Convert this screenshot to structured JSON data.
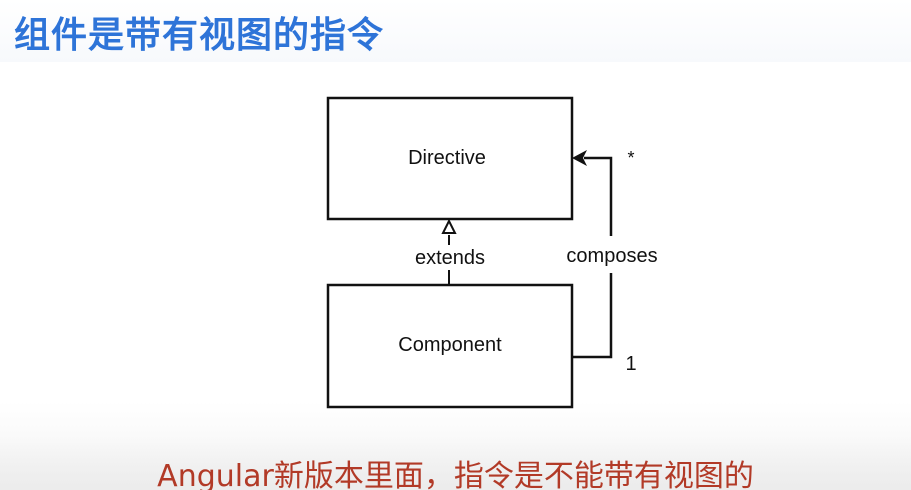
{
  "slide": {
    "title": "组件是带有视图的指令",
    "subtitle": "Angular新版本里面，指令是不能带有视图的"
  },
  "diagram": {
    "classes": {
      "directive": "Directive",
      "component": "Component"
    },
    "relations": {
      "extends_label": "extends",
      "composes_label": "composes",
      "multiplicity_target": "*",
      "multiplicity_source": "1"
    }
  },
  "colors": {
    "title": "#2e74d8",
    "subtitle": "#b23a27",
    "lines": "#111111"
  }
}
